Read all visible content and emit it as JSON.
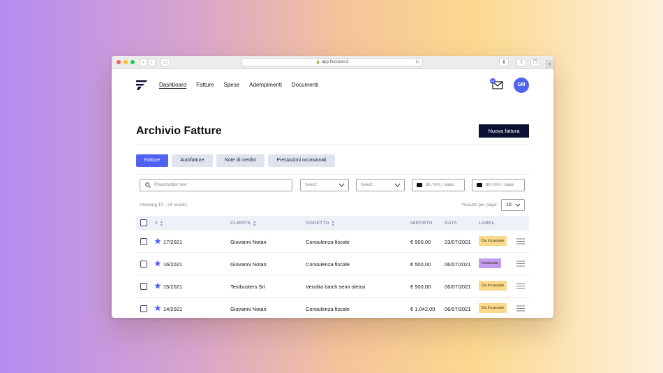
{
  "browser": {
    "url": "app.fiscozen.it"
  },
  "nav": {
    "links": [
      "Dashboard",
      "Fatture",
      "Spese",
      "Adempimenti",
      "Documenti"
    ],
    "active": "Dashboard",
    "mail_badge": "10",
    "avatar_initials": "GM"
  },
  "header": {
    "title": "Archivio Fatture",
    "new_button": "Nuova fattura"
  },
  "tabs": [
    {
      "label": "Fatture",
      "active": true
    },
    {
      "label": "Autofatture",
      "active": false
    },
    {
      "label": "Note di credito",
      "active": false
    },
    {
      "label": "Prestazioni occasionali",
      "active": false
    }
  ],
  "filters": {
    "search_placeholder": "Placeholder text",
    "select1": "Select",
    "select2": "Select",
    "date1": "dd / mm / aaaa",
    "date2": "dd / mm / aaaa"
  },
  "results": {
    "showing": "Showing 10 - 24 results",
    "per_page_label": "Results per page:",
    "per_page_value": "10"
  },
  "table": {
    "headers": [
      "#",
      "CLIENTE",
      "OGGETTO",
      "IMPORTO",
      "DATA",
      "LABEL"
    ],
    "rows": [
      {
        "num": "17/2021",
        "cliente": "Giovanni Notari",
        "oggetto": "Consulenza fiscale",
        "importo": "€ 500,00",
        "data": "23/07/2021",
        "label": "Da Incassare",
        "label_color": "#fbd98a"
      },
      {
        "num": "16/2021",
        "cliente": "Giovanni Notari",
        "oggetto": "Consulenza fiscale",
        "importo": "€ 500,00",
        "data": "06/07/2021",
        "label": "Incassata",
        "label_color": "#c49bf2"
      },
      {
        "num": "15/2021",
        "cliente": "Testbusters Srl",
        "oggetto": "Vendita batch semi oleosi",
        "importo": "€ 500,00",
        "data": "06/07/2021",
        "label": "Da Incassare",
        "label_color": "#fbd98a"
      },
      {
        "num": "14/2021",
        "cliente": "Giovanni Notari",
        "oggetto": "Consulenza fiscale",
        "importo": "€ 1.042,00",
        "data": "06/07/2021",
        "label": "Da Incassare",
        "label_color": "#fbd98a"
      }
    ]
  },
  "colors": {
    "accent": "#4f63f0",
    "primary_dark": "#0b1033"
  },
  "icons": [
    "logo-icon",
    "mail-icon",
    "search-icon",
    "chevron-down-icon",
    "calendar-icon",
    "sort-icon",
    "star-icon",
    "menu-icon"
  ]
}
